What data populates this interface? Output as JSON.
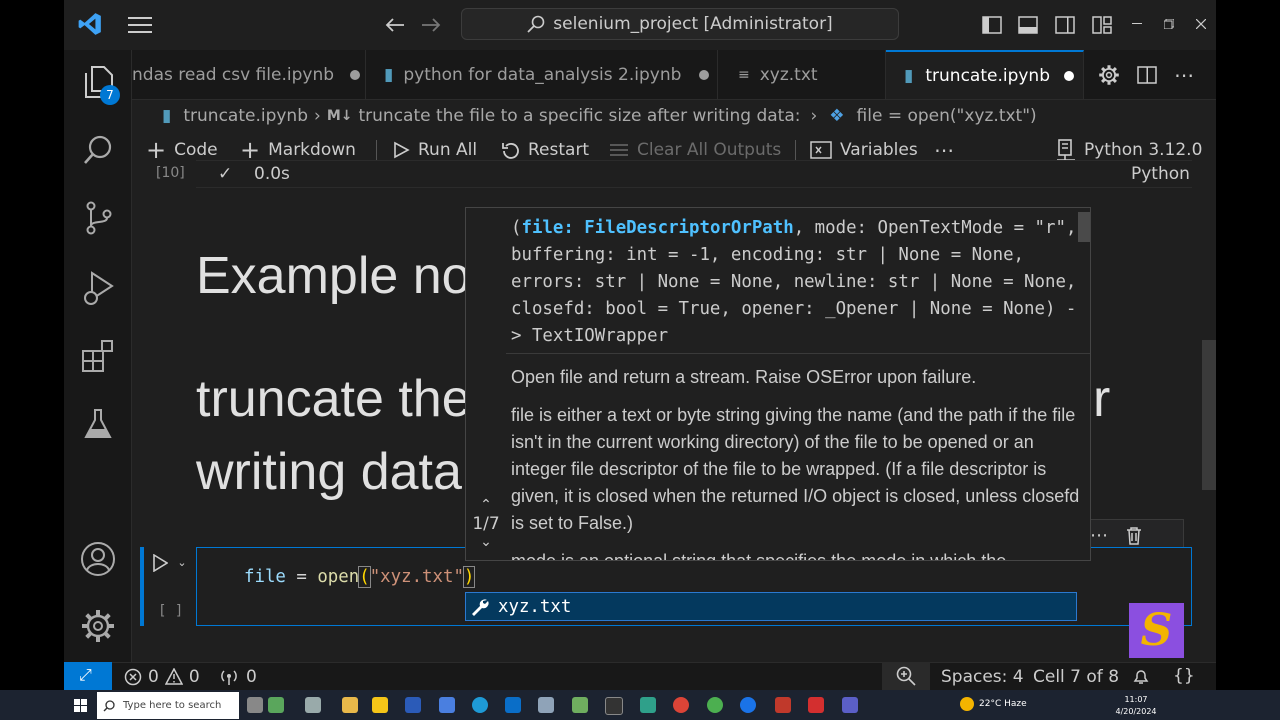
{
  "title_bar": {
    "search_text": "selenium_project [Administrator]"
  },
  "activity_bar": {
    "explorer_badge": "7"
  },
  "tabs": [
    {
      "label": "ndas read csv file.ipynb",
      "dirty": true
    },
    {
      "label": "python for data_analysis 2.ipynb",
      "dirty": true
    },
    {
      "label": "xyz.txt",
      "dirty": false
    },
    {
      "label": "truncate.ipynb",
      "dirty": true,
      "active": true
    }
  ],
  "breadcrumb": {
    "file": "truncate.ipynb",
    "section_marker": "M↓",
    "section": "truncate the file to a specific size after writing data:",
    "symbol": "file = open(\"xyz.txt\")"
  },
  "toolbar": {
    "code": "Code",
    "markdown": "Markdown",
    "run_all": "Run All",
    "restart": "Restart",
    "clear_outputs": "Clear All Outputs",
    "variables": "Variables",
    "more": "⋯",
    "kernel": "Python 3.12.0"
  },
  "output_cell": {
    "exec_count": "[10]",
    "check": "✓",
    "duration": "0.0s",
    "language": "Python"
  },
  "markdown_cell": {
    "heading": "Example no",
    "line1": "truncate the",
    "line1_tail": "r",
    "line2": "writing data"
  },
  "code_cell": {
    "code_var": "file",
    "code_eq": " = ",
    "code_func": "open",
    "code_open": "(",
    "code_str": "\"xyz.txt\"",
    "code_close": ")",
    "exec_count": "[ ]"
  },
  "hover": {
    "sig_open": "(",
    "sig_param": "file: FileDescriptorOrPath",
    "sig_rest": ", mode: OpenTextMode = \"r\", buffering: int = -1, encoding: str | None = None, errors: str | None = None, newline: str | None = None, closefd: bool = True, opener: _Opener | None = None) -> TextIOWrapper",
    "doc1": "Open file and return a stream. Raise OSError upon failure.",
    "doc2": "file is either a text or byte string giving the name (and the path if the file isn't in the current working directory) of the file to be opened or an integer file descriptor of the file to be wrapped. (If a file descriptor is given, it is closed when the returned I/O object is closed, unless closefd is set to False.)",
    "doc3": "mode is an optional string that specifies the mode in which the",
    "overload": "1/7"
  },
  "suggestion": {
    "label": "xyz.txt"
  },
  "status_bar": {
    "errors": "0",
    "warnings": "0",
    "ports": "0",
    "spaces": "Spaces: 4",
    "cell": "Cell 7 of 8",
    "braces": "{}"
  },
  "taskbar": {
    "search_placeholder": "Type here to search",
    "weather": "22°C  Haze",
    "time": "11:07",
    "date": "4/20/2024"
  }
}
